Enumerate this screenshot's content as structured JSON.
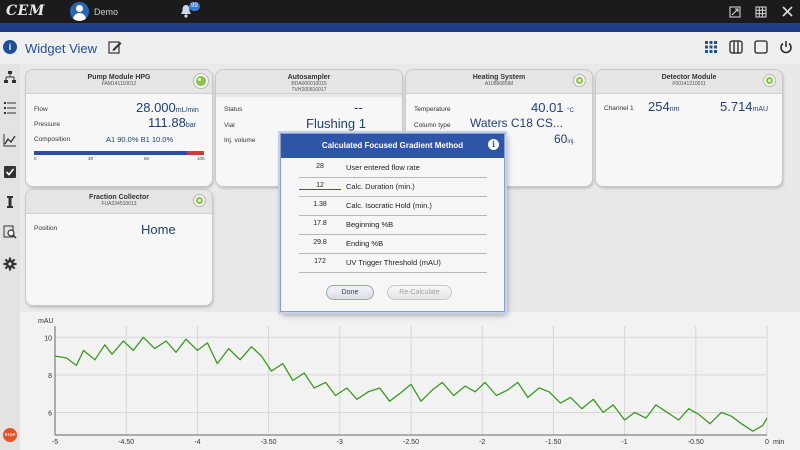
{
  "app": {
    "logo": "CEM",
    "user": "Demo",
    "notification_count": "99"
  },
  "header": {
    "title": "Widget View"
  },
  "widgets": {
    "pump": {
      "title": "Pump Module HPG",
      "serial": "FAM141110012",
      "flow_label": "Flow",
      "flow_value": "28.000",
      "flow_unit": "mL/min",
      "pressure_label": "Pressure",
      "pressure_value": "111.88",
      "pressure_unit": "bar",
      "composition_label": "Composition",
      "composition_value": "A1 90.0% B1 10.0%",
      "composition_b_percent": 10,
      "ticks": [
        "0",
        "30",
        "60",
        "100"
      ]
    },
    "autosampler": {
      "title": "Autosampler",
      "serial1": "BDA000010015",
      "serial2": "TVH200810017",
      "status_label": "Status",
      "status_value": "--",
      "vial_label": "Vial",
      "vial_value": "Flushing 1",
      "inj_label": "Inj. volume"
    },
    "heating": {
      "title": "Heating System",
      "serial": "A1086685IM",
      "temp_label": "Temperature",
      "temp_value": "40.01",
      "temp_unit": "°C",
      "column_label": "Column type",
      "column_value": "Waters C18 CS...",
      "inj_value": "60",
      "inj_unit": "inj."
    },
    "detector": {
      "title": "Detector Module",
      "serial": "F00141210011",
      "channel_label": "Channel 1",
      "wavelength": "254",
      "wavelength_unit": "nm",
      "absorbance": "5.714",
      "absorbance_unit": "mAU"
    },
    "fraction": {
      "title": "Fraction Collector",
      "serial": "FUA234510013",
      "position_label": "Position",
      "position_value": "Home"
    }
  },
  "dialog": {
    "title": "Calculated Focused Gradient Method",
    "rows": [
      {
        "value": "28",
        "label": "User entered flow rate"
      },
      {
        "value": "12",
        "label": "Calc. Duration (min.)"
      },
      {
        "value": "1.38",
        "label": "Calc. Isocratic Hold (min.)"
      },
      {
        "value": "17.8",
        "label": "Beginning %B"
      },
      {
        "value": "29.8",
        "label": "Ending %B"
      },
      {
        "value": "172",
        "label": "UV Trigger Threshold (mAU)"
      }
    ],
    "done_label": "Done",
    "recalc_label": "Re-Calculate"
  },
  "chart_data": {
    "type": "line",
    "ylabel": "mAU",
    "xlabel_unit": "min",
    "xlim": [
      -5,
      0
    ],
    "ylim": [
      4.8,
      10.6
    ],
    "y_ticks": [
      6,
      8,
      10
    ],
    "x_ticks": [
      "-5",
      "-4.50",
      "-4",
      "-3.50",
      "-3",
      "-2.50",
      "-2",
      "-1.50",
      "-1",
      "-0.50",
      "0"
    ],
    "grid": true,
    "series": [
      {
        "color": "#3b9a1f",
        "x": [
          -5,
          -4.92,
          -4.85,
          -4.8,
          -4.72,
          -4.65,
          -4.6,
          -4.52,
          -4.45,
          -4.38,
          -4.3,
          -4.22,
          -4.15,
          -4.08,
          -4.0,
          -3.93,
          -3.86,
          -3.78,
          -3.7,
          -3.62,
          -3.55,
          -3.48,
          -3.4,
          -3.33,
          -3.25,
          -3.18,
          -3.1,
          -3.03,
          -2.95,
          -2.88,
          -2.8,
          -2.72,
          -2.65,
          -2.58,
          -2.5,
          -2.43,
          -2.35,
          -2.28,
          -2.2,
          -2.12,
          -2.05,
          -1.98,
          -1.9,
          -1.82,
          -1.75,
          -1.68,
          -1.6,
          -1.53,
          -1.45,
          -1.38,
          -1.3,
          -1.22,
          -1.15,
          -1.08,
          -1.0,
          -0.93,
          -0.85,
          -0.78,
          -0.7,
          -0.62,
          -0.55,
          -0.48,
          -0.4,
          -0.32,
          -0.25,
          -0.18,
          -0.1,
          -0.03,
          0
        ],
        "y": [
          9.0,
          8.9,
          8.5,
          9.3,
          8.8,
          9.6,
          9.1,
          9.8,
          9.3,
          10.0,
          9.4,
          9.8,
          9.2,
          9.9,
          9.3,
          9.7,
          8.6,
          9.4,
          8.8,
          9.5,
          9.0,
          8.2,
          8.6,
          7.7,
          8.1,
          7.3,
          7.6,
          6.9,
          7.3,
          6.7,
          7.1,
          7.3,
          6.6,
          7.0,
          7.5,
          6.6,
          7.2,
          7.6,
          6.9,
          7.4,
          7.1,
          7.6,
          6.9,
          7.2,
          7.6,
          6.8,
          7.3,
          7.1,
          6.5,
          6.8,
          6.2,
          6.7,
          6.0,
          6.4,
          5.6,
          6.0,
          5.7,
          6.4,
          6.0,
          5.6,
          6.2,
          5.9,
          5.4,
          6.0,
          5.8,
          5.4,
          5.0,
          5.3,
          5.7
        ]
      }
    ]
  }
}
